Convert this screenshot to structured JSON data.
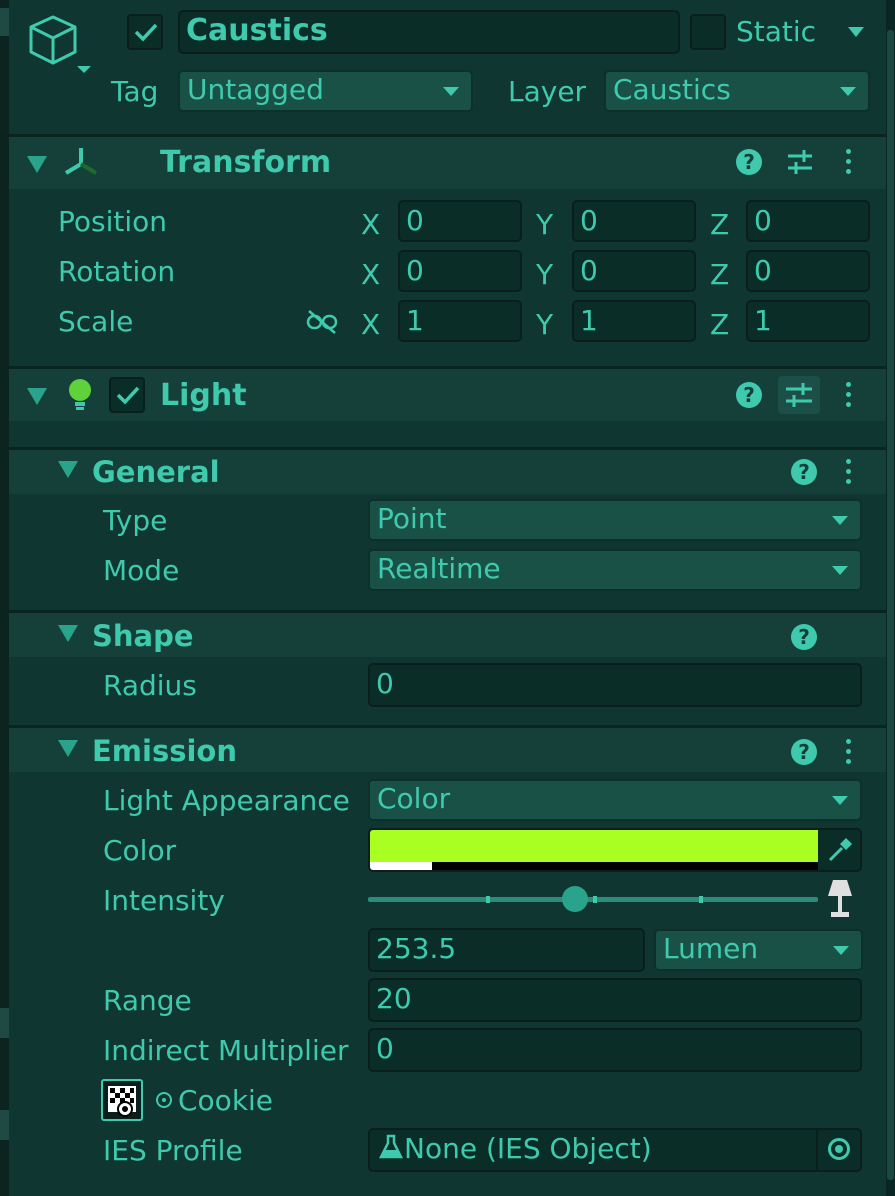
{
  "gameobject": {
    "active": true,
    "name": "Caustics",
    "static_label": "Static",
    "static_checked": false,
    "tag_label": "Tag",
    "tag_value": "Untagged",
    "layer_label": "Layer",
    "layer_value": "Caustics"
  },
  "transform": {
    "title": "Transform",
    "rows": [
      {
        "label": "Position",
        "x": "0",
        "y": "0",
        "z": "0"
      },
      {
        "label": "Rotation",
        "x": "0",
        "y": "0",
        "z": "0"
      },
      {
        "label": "Scale",
        "x": "1",
        "y": "1",
        "z": "1"
      }
    ],
    "axis_x": "X",
    "axis_y": "Y",
    "axis_z": "Z"
  },
  "light": {
    "title": "Light",
    "enabled": true,
    "general": {
      "title": "General",
      "type_label": "Type",
      "type_value": "Point",
      "mode_label": "Mode",
      "mode_value": "Realtime"
    },
    "shape": {
      "title": "Shape",
      "radius_label": "Radius",
      "radius_value": "0"
    },
    "emission": {
      "title": "Emission",
      "appearance_label": "Light Appearance",
      "appearance_value": "Color",
      "color_label": "Color",
      "color_value": "#aaff22",
      "intensity_label": "Intensity",
      "intensity_slider_fraction": 0.46,
      "intensity_value": "253.5",
      "intensity_unit": "Lumen",
      "range_label": "Range",
      "range_value": "20",
      "indirect_label": "Indirect Multiplier",
      "indirect_value": "0",
      "cookie_label": "Cookie",
      "ies_label": "IES Profile",
      "ies_value": "None (IES Object)"
    }
  },
  "colors": {
    "accent": "#3fcaae",
    "background": "#0f3630",
    "header": "#154039",
    "light_bulb": "#5fd13a"
  }
}
